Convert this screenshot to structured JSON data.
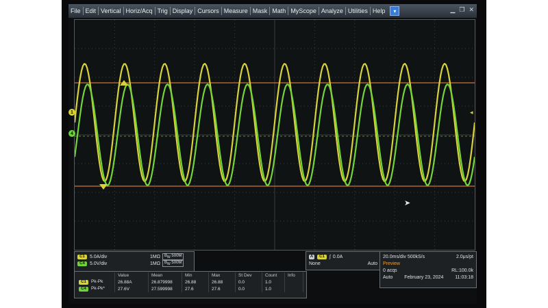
{
  "menu": {
    "items": [
      "File",
      "Edit",
      "Vertical",
      "Horiz/Acq",
      "Trig",
      "Display",
      "Cursors",
      "Measure",
      "Mask",
      "Math",
      "MyScope",
      "Analyze",
      "Utilities",
      "Help"
    ],
    "dropdown_icon": "chevron-down-icon",
    "window_buttons": [
      "minimize-icon",
      "restore-icon",
      "close-icon"
    ]
  },
  "channels": [
    {
      "id": "C1",
      "scale": "5.0A/div",
      "impedance": "1MΩ",
      "bandwidth": "500M",
      "color": "#d7d43a"
    },
    {
      "id": "C4",
      "scale": "5.0V/div",
      "impedance": "1MΩ",
      "bandwidth": "500M",
      "color": "#6fd23b"
    }
  ],
  "trigger": {
    "source": "C1",
    "level": "0.0A",
    "mode_left": "None",
    "mode_right": "Auto"
  },
  "timebase": {
    "scale": "20.0ms/div",
    "sample_rate": "500kS/s",
    "resolution": "2.0μs/pt",
    "state": "Preview",
    "acqs": "0 acqs",
    "record_length": "RL:100.0k",
    "mode": "Auto",
    "date": "February 23, 2024",
    "time": "11:03:18"
  },
  "measurements": {
    "headers": [
      "",
      "Value",
      "Mean",
      "Min",
      "Max",
      "St Dev",
      "Count",
      "Info"
    ],
    "rows": [
      {
        "ch": "C1",
        "name": "Pk-Pk",
        "value": "26.88A",
        "mean": "26.879998",
        "min": "26.88",
        "max": "26.88",
        "stdev": "0.0",
        "count": "1.0",
        "info": ""
      },
      {
        "ch": "C4",
        "name": "Pk-Pk*",
        "value": "27.6V",
        "mean": "27.599998",
        "min": "27.6",
        "max": "27.6",
        "stdev": "0.0",
        "count": "1.0",
        "info": ""
      }
    ]
  },
  "waveforms": {
    "c1_color": "#d8d23c",
    "c4_color": "#74d43c",
    "cycles_visible": 10
  },
  "markers": {
    "c1_label": "1",
    "c4_label": "4"
  }
}
